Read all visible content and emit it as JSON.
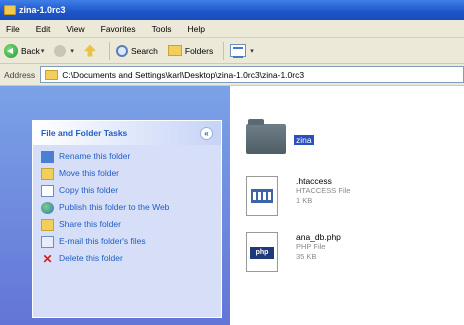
{
  "window": {
    "title": "zina-1.0rc3"
  },
  "menubar": {
    "items": [
      "File",
      "Edit",
      "View",
      "Favorites",
      "Tools",
      "Help"
    ]
  },
  "toolbar": {
    "back_label": "Back",
    "search_label": "Search",
    "folders_label": "Folders"
  },
  "address": {
    "label": "Address",
    "value": "C:\\Documents and Settings\\karl\\Desktop\\zina-1.0rc3\\zina-1.0rc3"
  },
  "tasks": {
    "title": "File and Folder Tasks",
    "items": [
      {
        "label": "Rename this folder",
        "icon": "rename-icon"
      },
      {
        "label": "Move this folder",
        "icon": "move-icon"
      },
      {
        "label": "Copy this folder",
        "icon": "copy-icon"
      },
      {
        "label": "Publish this folder to the Web",
        "icon": "publish-icon"
      },
      {
        "label": "Share this folder",
        "icon": "share-icon"
      },
      {
        "label": "E-mail this folder's files",
        "icon": "email-icon"
      },
      {
        "label": "Delete this folder",
        "icon": "delete-icon"
      }
    ]
  },
  "files": [
    {
      "name": "zina",
      "type": "",
      "size": ""
    },
    {
      "name": ".htaccess",
      "type": "HTACCESS File",
      "size": "1 KB"
    },
    {
      "name": "ana_db.php",
      "type": "PHP File",
      "size": "35 KB"
    }
  ],
  "colors": {
    "accent": "#215dc6",
    "selection": "#2a4fbf"
  }
}
